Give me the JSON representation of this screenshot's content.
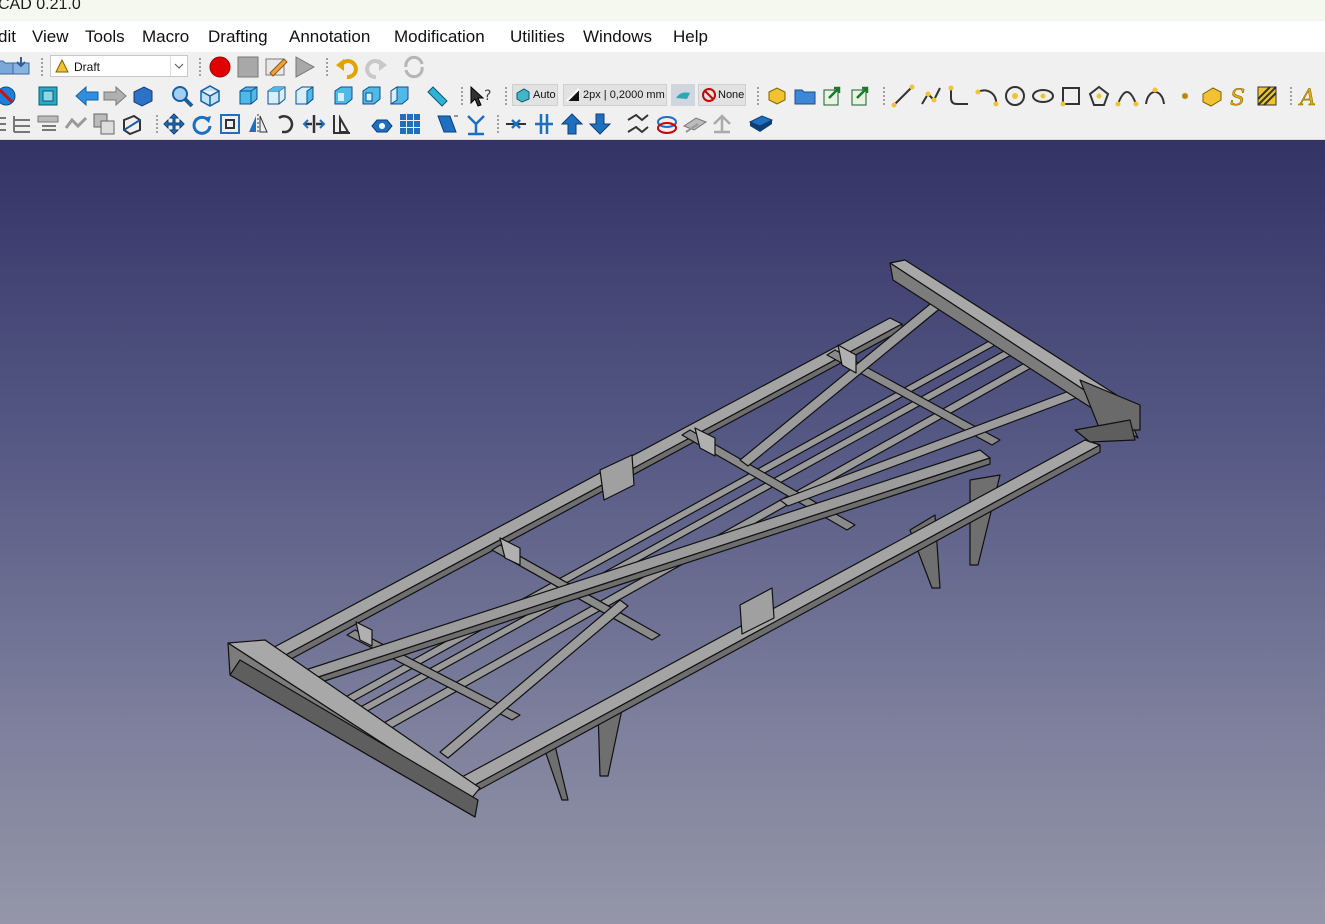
{
  "window": {
    "title": "CAD 0.21.0"
  },
  "menu": {
    "items": [
      "dit",
      "View",
      "Tools",
      "Macro",
      "Drafting",
      "Annotation",
      "Modification",
      "Utilities",
      "Windows",
      "Help"
    ]
  },
  "toolbar": {
    "workbench_selected": "Draft",
    "auto_label": "Auto",
    "line_width_label": "2px | 0,2000 mm",
    "none_label": "None"
  },
  "colors": {
    "viewport_top": "#333366",
    "viewport_bottom": "#9596a8",
    "model_face": "#8e8e8e",
    "model_edge": "#111111",
    "record_red": "#e00000"
  },
  "icons": {
    "file_toolbar": [
      "open-icon",
      "save-icon"
    ],
    "macro_toolbar": [
      "record-macro-icon",
      "stop-macro-icon",
      "edit-macro-icon",
      "execute-macro-icon"
    ],
    "edit_toolbar": [
      "undo-icon",
      "redo-icon",
      "refresh-icon"
    ],
    "view_toolbar": [
      "fit-all-icon",
      "draw-style-icon",
      "bounding-box-icon",
      "back-icon",
      "forward-icon",
      "workbench-icon",
      "zoom-icon",
      "isometric-icon",
      "front-view-icon",
      "top-view-icon",
      "right-view-icon",
      "rear-view-icon",
      "bottom-view-icon",
      "left-view-icon",
      "measure-icon",
      "whats-this-icon"
    ],
    "draft_tray": [
      "construction-icon",
      "auto-plane-icon",
      "line-width-icon",
      "color-icon",
      "snap-none-icon"
    ],
    "draft_create": [
      "create-icon",
      "folder-icon",
      "forward-arrow-icon",
      "forward-arrow-alt-icon",
      "line-icon",
      "wire-icon",
      "fillet-icon",
      "arc-icon",
      "circle-icon",
      "ellipse-icon",
      "rectangle-icon",
      "polygon-icon",
      "bspline-icon",
      "bezier-icon",
      "point-icon",
      "facebinder-icon",
      "shapestring-icon",
      "hatch-icon",
      "text-icon"
    ],
    "row3": [
      "snap-icon",
      "layers-icon",
      "grid-icon",
      "tree-icon",
      "clone-icon",
      "scale-icon",
      "move-icon",
      "rotate-icon",
      "offset-icon",
      "mirror-icon",
      "trimex-icon",
      "stretch-icon",
      "array-icon",
      "polar-array-icon",
      "wire-to-bspline-icon",
      "draft-to-sketch-icon",
      "upgrade-icon",
      "downgrade-icon",
      "join-icon",
      "split-icon",
      "up-icon",
      "down-icon",
      "edit-icon",
      "sub-element-icon",
      "shape2dview-icon",
      "working-plane-icon"
    ]
  }
}
